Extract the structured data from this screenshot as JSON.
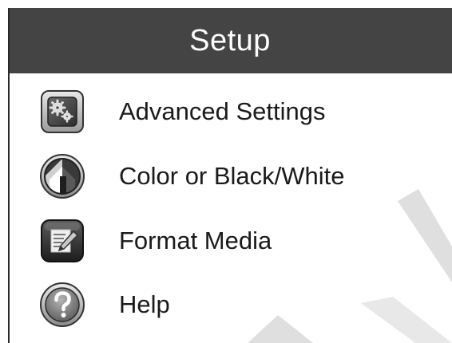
{
  "header": {
    "title": "Setup"
  },
  "menu": {
    "items": [
      {
        "label": "Advanced Settings",
        "icon": "gears-icon"
      },
      {
        "label": "Color or Black/White",
        "icon": "color-mode-icon"
      },
      {
        "label": "Format Media",
        "icon": "format-media-icon"
      },
      {
        "label": "Help",
        "icon": "help-icon"
      }
    ]
  },
  "colors": {
    "header_bg": "#444444",
    "header_text": "#ffffff",
    "label_text": "#1a1a1a",
    "watermark": "#d9d9d9"
  }
}
